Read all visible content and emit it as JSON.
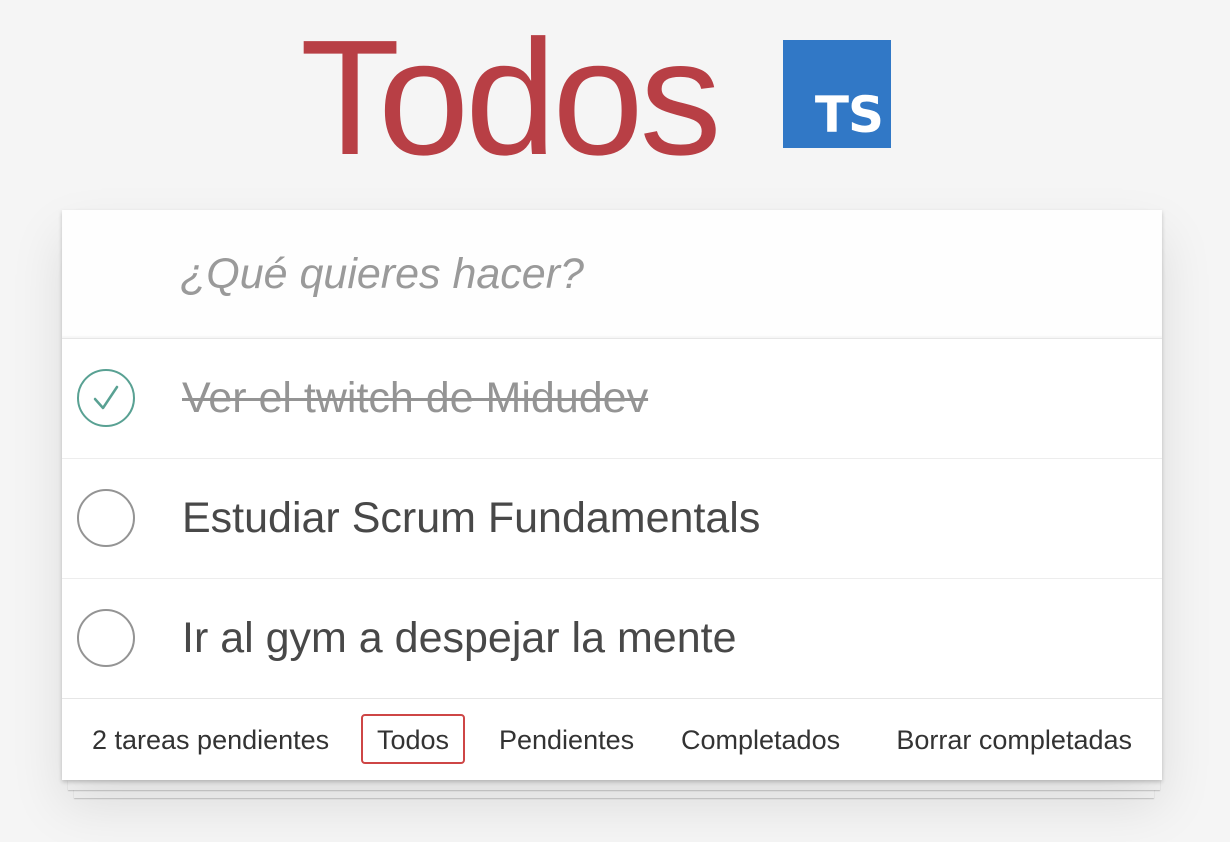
{
  "header": {
    "title": "Todos",
    "logo_text": "TS",
    "logo_color": "#3178c6",
    "title_color": "#b83f45"
  },
  "new_todo": {
    "placeholder": "¿Qué quieres hacer?",
    "value": ""
  },
  "todos": [
    {
      "title": "Ver el twitch de Midudev",
      "completed": true
    },
    {
      "title": "Estudiar Scrum Fundamentals",
      "completed": false
    },
    {
      "title": "Ir al gym a despejar la mente",
      "completed": false
    }
  ],
  "footer": {
    "count_text": "2 tareas pendientes",
    "filters": [
      {
        "label": "Todos",
        "selected": true
      },
      {
        "label": "Pendientes",
        "selected": false
      },
      {
        "label": "Completados",
        "selected": false
      }
    ],
    "clear_completed_label": "Borrar completadas",
    "selected_border_color": "#ce4646"
  },
  "icons": {
    "checked": "check-icon",
    "unchecked": "empty-circle-icon"
  }
}
